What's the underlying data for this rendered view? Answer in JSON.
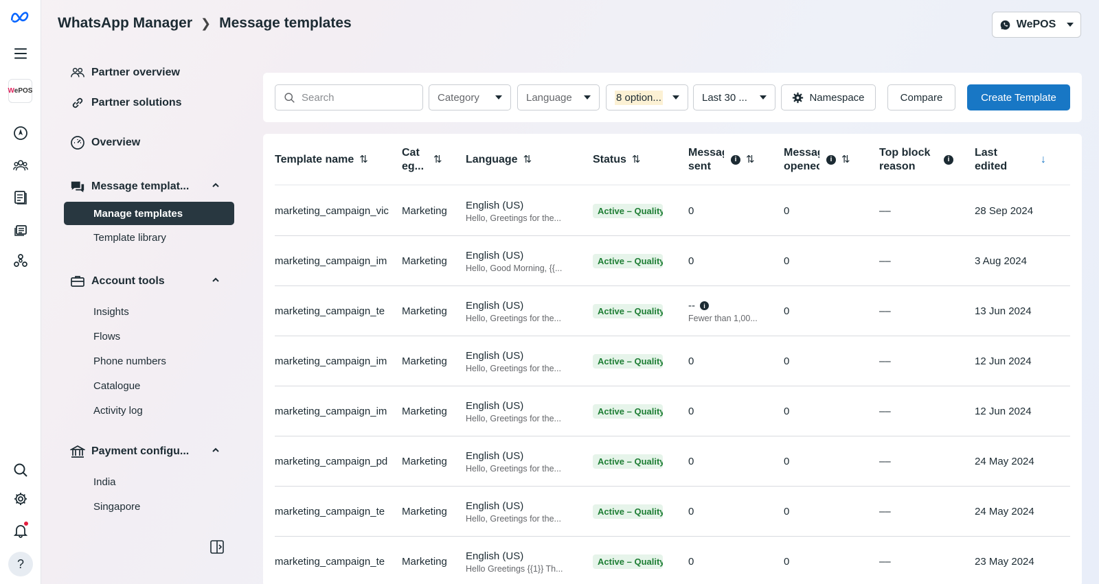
{
  "breadcrumb": {
    "app": "WhatsApp Manager",
    "page": "Message templates"
  },
  "account": {
    "name": "WePOS",
    "icon": "whatsapp-icon"
  },
  "rail": {
    "brand_logo": "WePOS",
    "icons": [
      "meta-logo-icon",
      "menu-icon",
      "compass-icon",
      "people-icon",
      "catalog-icon",
      "templates-icon",
      "network-icon",
      "search-icon",
      "settings-icon",
      "bell-icon",
      "help-icon"
    ],
    "help_label": "?"
  },
  "nav": {
    "partner_overview": "Partner overview",
    "partner_solutions": "Partner solutions",
    "overview": "Overview",
    "message_templates": "Message templat...",
    "manage_templates": "Manage templates",
    "template_library": "Template library",
    "account_tools": "Account tools",
    "insights": "Insights",
    "flows": "Flows",
    "phone_numbers": "Phone numbers",
    "catalogue": "Catalogue",
    "activity_log": "Activity log",
    "payment_config": "Payment configu...",
    "india": "India",
    "singapore": "Singapore"
  },
  "toolbar": {
    "search_placeholder": "Search",
    "category": "Category",
    "language": "Language",
    "status_filter": "8 option...",
    "date_range": "Last 30 ...",
    "namespace": "Namespace",
    "compare": "Compare",
    "create": "Create Template"
  },
  "table": {
    "headers": {
      "name": "Template name",
      "category_l1": "Cat",
      "category_l2": "eg...",
      "language": "Language",
      "status": "Status",
      "sent_l1": "Messag",
      "sent_l2": "sent",
      "opened_l1": "Messag",
      "opened_l2": "openec",
      "block_l1": "Top block",
      "block_l2": "reason",
      "edited_l1": "Last",
      "edited_l2": "edited"
    },
    "rows": [
      {
        "name": "marketing_campaign_vic",
        "category": "Marketing",
        "language": "English (US)",
        "preview": "Hello, Greetings for the...",
        "status": "Active – Quality",
        "sent": "0",
        "sent_note": "",
        "opened": "0",
        "block": "––",
        "edited": "28 Sep 2024"
      },
      {
        "name": "marketing_campaign_im",
        "category": "Marketing",
        "language": "English (US)",
        "preview": "Hello, Good Morning, {{...",
        "status": "Active – Quality",
        "sent": "0",
        "sent_note": "",
        "opened": "0",
        "block": "––",
        "edited": "3 Aug 2024"
      },
      {
        "name": "marketing_campaign_te",
        "category": "Marketing",
        "language": "English (US)",
        "preview": "Hello, Greetings for the...",
        "status": "Active – Quality",
        "sent": "--",
        "sent_note": "Fewer than 1,00...",
        "opened": "0",
        "block": "––",
        "edited": "13 Jun 2024"
      },
      {
        "name": "marketing_campaign_im",
        "category": "Marketing",
        "language": "English (US)",
        "preview": "Hello, Greetings for the...",
        "status": "Active – Quality",
        "sent": "0",
        "sent_note": "",
        "opened": "0",
        "block": "––",
        "edited": "12 Jun 2024"
      },
      {
        "name": "marketing_campaign_im",
        "category": "Marketing",
        "language": "English (US)",
        "preview": "Hello, Greetings for the...",
        "status": "Active – Quality",
        "sent": "0",
        "sent_note": "",
        "opened": "0",
        "block": "––",
        "edited": "12 Jun 2024"
      },
      {
        "name": "marketing_campaign_pd",
        "category": "Marketing",
        "language": "English (US)",
        "preview": "Hello, Greetings for the...",
        "status": "Active – Quality",
        "sent": "0",
        "sent_note": "",
        "opened": "0",
        "block": "––",
        "edited": "24 May 2024"
      },
      {
        "name": "marketing_campaign_te",
        "category": "Marketing",
        "language": "English (US)",
        "preview": "Hello, Greetings for the...",
        "status": "Active – Quality",
        "sent": "0",
        "sent_note": "",
        "opened": "0",
        "block": "––",
        "edited": "24 May 2024"
      },
      {
        "name": "marketing_campaign_te",
        "category": "Marketing",
        "language": "English (US)",
        "preview": "Hello Greetings {{1}} Th...",
        "status": "Active – Quality",
        "sent": "0",
        "sent_note": "",
        "opened": "0",
        "block": "––",
        "edited": "23 May 2024"
      }
    ]
  },
  "colors": {
    "primary": "#1877c5",
    "active_nav": "#283740",
    "badge_bg": "#e6f4ea",
    "badge_text": "#1e7e34"
  }
}
